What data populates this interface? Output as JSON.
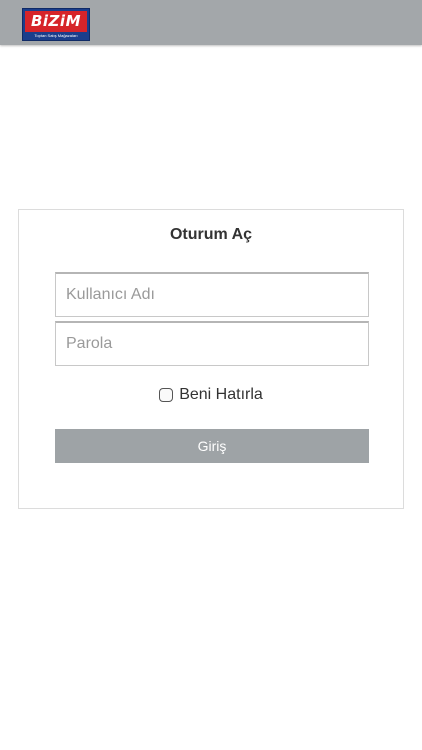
{
  "header": {
    "logo_text": "BiZiM",
    "logo_subtext": "Toptan Satış Mağazaları"
  },
  "login": {
    "title": "Oturum Aç",
    "username_placeholder": "Kullanıcı Adı",
    "password_placeholder": "Parola",
    "remember_label": "Beni Hatırla",
    "remember_checked": false,
    "submit_label": "Giriş"
  },
  "colors": {
    "topbar": "#a3a7aa",
    "button": "#9ea3a6",
    "logo_red": "#d6242a",
    "logo_blue": "#1a3e8c"
  }
}
